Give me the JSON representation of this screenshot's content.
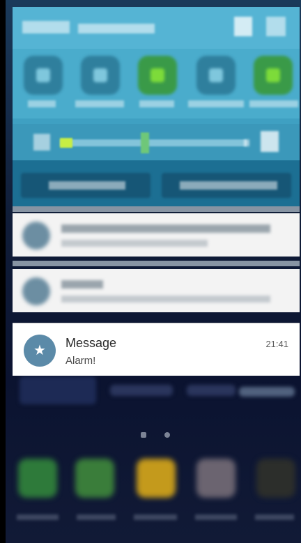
{
  "notification": {
    "title": "Message",
    "body": "Alarm!",
    "time": "21:41",
    "icon": "star-icon"
  },
  "colors": {
    "quick_panel": "#3fa0c2",
    "notification_icon_bg": "#5b8aa8"
  }
}
